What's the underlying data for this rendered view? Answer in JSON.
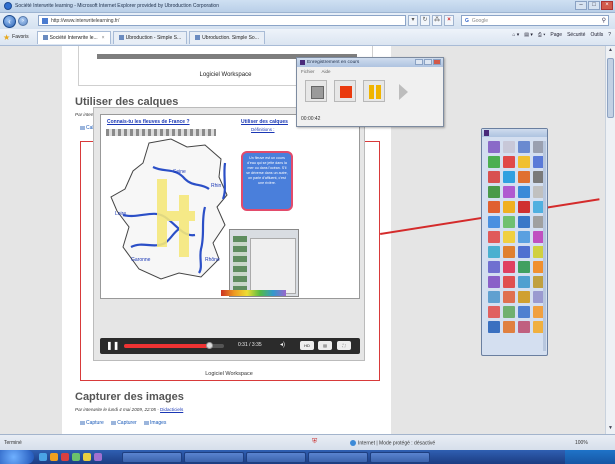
{
  "window": {
    "title": "Société Interwrite learning - Microsoft Internet Explorer provided by Ubroduction Corporation"
  },
  "address": {
    "url": "http://www.interwritelearning.fr/",
    "search_engine": "Google"
  },
  "favorites": {
    "label": "Favoris",
    "tabs": [
      {
        "label": "Société Interwrite le..."
      },
      {
        "label": "Ubroduction - Simple S..."
      },
      {
        "label": "Ubroduction. Simple So..."
      }
    ],
    "commands": [
      "Page",
      "Sécurité",
      "Outils"
    ]
  },
  "page": {
    "header_caption": "Logiciel Workspace",
    "section1": {
      "title": "Utiliser des calques",
      "byline": "Par interwrite le lundi 4 mai 2009, 22:09 -",
      "byline_link": "Didacticiels",
      "tags": [
        "Calques"
      ]
    },
    "video": {
      "link_left": "Connais-tu les fleuves de France ?",
      "link_right": "Utiliser des calques",
      "link_right_sub": "Définitions :",
      "popup_text": "Un fleuve est un cours d'eau qui se jette dans la mer ou dans l'océan. S'il se déverse dans un autre, on parle d'affluent, c'est une rivière.",
      "time": "0:31 / 3:35",
      "progress": 0.85,
      "caption": "Logiciel Workspace"
    },
    "section2": {
      "title": "Capturer des images",
      "byline": "Par interwrite le lundi 4 mai 2009, 22:05 -",
      "byline_link": "Didacticiels",
      "tags": [
        "Capture",
        "Capturer",
        "Images"
      ]
    }
  },
  "recorder": {
    "title": "Enregistrement en cours",
    "menu": [
      "Fichier",
      "Aide"
    ],
    "time": "00:00:42"
  },
  "status": {
    "left": "Terminé",
    "zone": "Internet | Mode protégé : désactivé",
    "zoom": "100%"
  },
  "colors": {
    "highlight": "#d83a3a",
    "record": "#ea3a0e",
    "pause": "#f0b400"
  }
}
